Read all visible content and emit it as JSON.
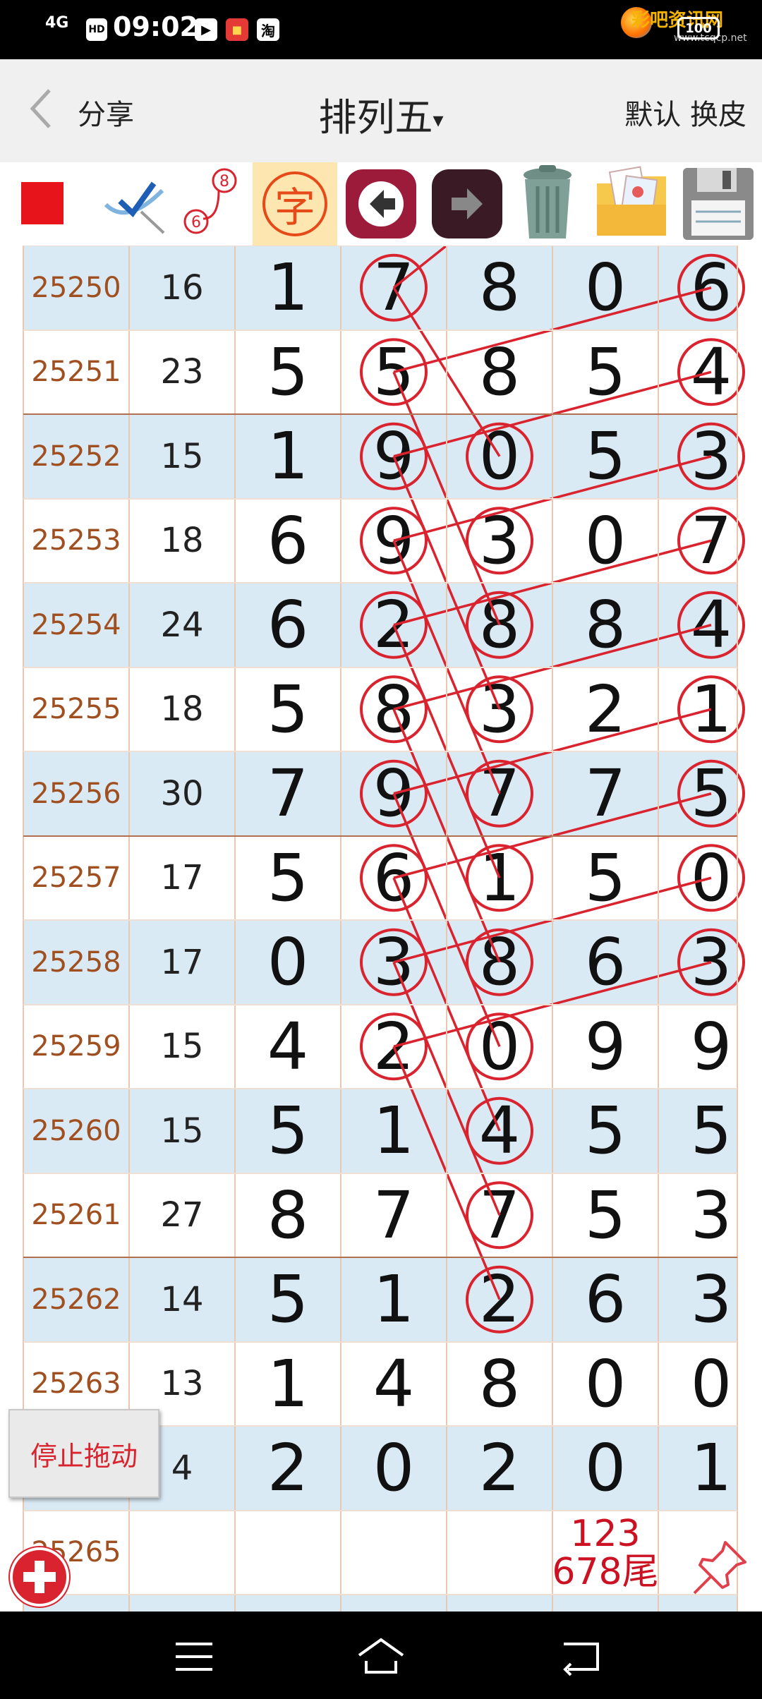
{
  "status_bar": {
    "signal": "4G",
    "time": "09:02",
    "icons": [
      "hd-icon",
      "play-icon",
      "app-icon",
      "taobao-icon"
    ],
    "icon_hd": "HD",
    "icon_tao": "淘",
    "battery": "100",
    "watermark": "彩吧资讯网",
    "watermark_url": "www.tcqcp.net"
  },
  "header": {
    "back_icon": "chevron-left-icon",
    "share": "分享",
    "title": "排列五",
    "title_caret": "▾",
    "right": "默认 换皮"
  },
  "toolbar": {
    "icons": [
      "red-square-icon",
      "pen-check-icon",
      "connect-icon",
      "char-icon",
      "arrow-left-icon",
      "arrow-right-icon",
      "trash-icon",
      "photo-folder-icon",
      "floppy-save-icon"
    ],
    "connect_labels": [
      "6",
      "8"
    ],
    "char_label": "字"
  },
  "rows": [
    {
      "issue": "25250",
      "sum": "16",
      "digits": [
        "1",
        "7",
        "8",
        "0",
        "6"
      ]
    },
    {
      "issue": "25251",
      "sum": "23",
      "digits": [
        "5",
        "5",
        "8",
        "5",
        "4"
      ]
    },
    {
      "issue": "25252",
      "sum": "15",
      "digits": [
        "1",
        "9",
        "0",
        "5",
        "3"
      ]
    },
    {
      "issue": "25253",
      "sum": "18",
      "digits": [
        "6",
        "9",
        "3",
        "0",
        "7"
      ]
    },
    {
      "issue": "25254",
      "sum": "24",
      "digits": [
        "6",
        "2",
        "8",
        "8",
        "4"
      ]
    },
    {
      "issue": "25255",
      "sum": "18",
      "digits": [
        "5",
        "8",
        "3",
        "2",
        "1"
      ]
    },
    {
      "issue": "25256",
      "sum": "30",
      "digits": [
        "7",
        "9",
        "7",
        "7",
        "5"
      ]
    },
    {
      "issue": "25257",
      "sum": "17",
      "digits": [
        "5",
        "6",
        "1",
        "5",
        "0"
      ]
    },
    {
      "issue": "25258",
      "sum": "17",
      "digits": [
        "0",
        "3",
        "8",
        "6",
        "3"
      ]
    },
    {
      "issue": "25259",
      "sum": "15",
      "digits": [
        "4",
        "2",
        "0",
        "9",
        "9"
      ]
    },
    {
      "issue": "25260",
      "sum": "15",
      "digits": [
        "5",
        "1",
        "4",
        "5",
        "5"
      ]
    },
    {
      "issue": "25261",
      "sum": "27",
      "digits": [
        "8",
        "7",
        "7",
        "5",
        "3"
      ]
    },
    {
      "issue": "25262",
      "sum": "14",
      "digits": [
        "5",
        "1",
        "2",
        "6",
        "3"
      ]
    },
    {
      "issue": "25263",
      "sum": "13",
      "digits": [
        "1",
        "4",
        "8",
        "0",
        "0"
      ]
    },
    {
      "issue": "",
      "sum": "4",
      "digits": [
        "2",
        "0",
        "2",
        "0",
        "1"
      ]
    },
    {
      "issue": "25265",
      "sum": "",
      "digits": [
        "",
        "",
        "",
        "",
        ""
      ],
      "note": [
        "123",
        "678尾"
      ]
    },
    {
      "issue": "",
      "sum": "",
      "digits": [
        "",
        "",
        "",
        "",
        ""
      ]
    }
  ],
  "circled": [
    [
      0,
      1
    ],
    [
      0,
      4
    ],
    [
      1,
      1
    ],
    [
      1,
      4
    ],
    [
      2,
      1
    ],
    [
      2,
      2
    ],
    [
      2,
      4
    ],
    [
      3,
      1
    ],
    [
      3,
      2
    ],
    [
      3,
      4
    ],
    [
      4,
      1
    ],
    [
      4,
      2
    ],
    [
      4,
      4
    ],
    [
      5,
      1
    ],
    [
      5,
      2
    ],
    [
      5,
      4
    ],
    [
      6,
      1
    ],
    [
      6,
      2
    ],
    [
      6,
      4
    ],
    [
      7,
      1
    ],
    [
      7,
      2
    ],
    [
      7,
      4
    ],
    [
      8,
      1
    ],
    [
      8,
      2
    ],
    [
      8,
      4
    ],
    [
      9,
      1
    ],
    [
      9,
      2
    ],
    [
      10,
      2
    ],
    [
      11,
      2
    ],
    [
      12,
      2
    ]
  ],
  "lines": [
    [
      [
        0,
        1
      ],
      [
        2,
        2
      ]
    ],
    [
      [
        1,
        1
      ],
      [
        4,
        2
      ]
    ],
    [
      [
        2,
        1
      ],
      [
        5,
        2
      ]
    ],
    [
      [
        3,
        1
      ],
      [
        6,
        2
      ]
    ],
    [
      [
        4,
        1
      ],
      [
        7,
        2
      ]
    ],
    [
      [
        5,
        1
      ],
      [
        8,
        2
      ]
    ],
    [
      [
        6,
        1
      ],
      [
        9,
        2
      ]
    ],
    [
      [
        7,
        1
      ],
      [
        10,
        2
      ]
    ],
    [
      [
        8,
        1
      ],
      [
        11,
        2
      ]
    ],
    [
      [
        9,
        1
      ],
      [
        12,
        2
      ]
    ],
    [
      [
        0,
        4
      ],
      [
        1,
        1
      ]
    ],
    [
      [
        1,
        4
      ],
      [
        2,
        1
      ]
    ],
    [
      [
        2,
        4
      ],
      [
        3,
        1
      ]
    ],
    [
      [
        3,
        4
      ],
      [
        4,
        1
      ]
    ],
    [
      [
        4,
        4
      ],
      [
        5,
        1
      ]
    ],
    [
      [
        5,
        4
      ],
      [
        6,
        1
      ]
    ],
    [
      [
        6,
        4
      ],
      [
        7,
        1
      ]
    ],
    [
      [
        7,
        4
      ],
      [
        8,
        1
      ]
    ],
    [
      [
        8,
        4
      ],
      [
        9,
        1
      ]
    ],
    [
      [
        0,
        1
      ],
      [
        -1,
        2
      ]
    ]
  ],
  "floating": {
    "stop_drag": "停止拖动",
    "add_icon": "plus-icon",
    "pin_icon": "pin-icon"
  },
  "nav_bar": {
    "icons": [
      "menu-icon",
      "home-icon",
      "back-icon"
    ]
  },
  "colors": {
    "mark": "#d9232e",
    "row_shade": "#daeaf4",
    "issue_text": "#a05020",
    "red_square": "#e8141b"
  }
}
